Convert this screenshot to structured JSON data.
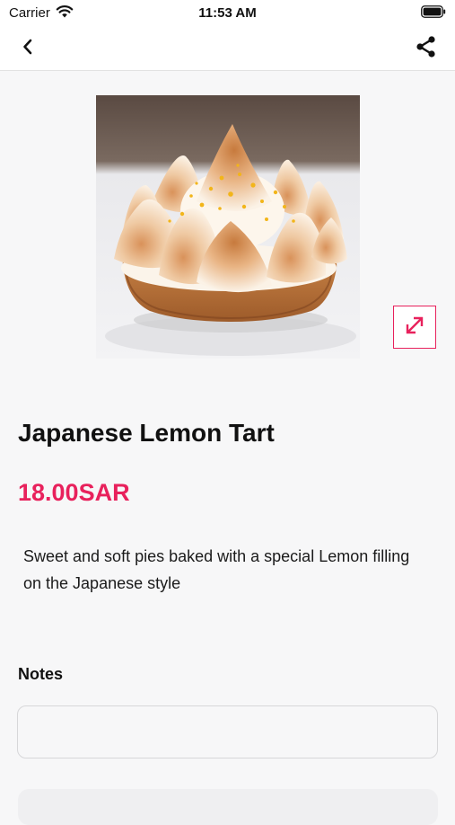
{
  "status_bar": {
    "carrier": "Carrier",
    "time": "11:53 AM"
  },
  "nav": {
    "back_icon": "chevron-left-icon",
    "share_icon": "share-icon"
  },
  "product": {
    "image_description": "lemon tart with toasted meringue peaks",
    "title": "Japanese Lemon Tart",
    "price": "18.00SAR",
    "description": "Sweet and soft pies baked with a special Lemon filling on the Japanese style",
    "expand_icon": "expand-icon"
  },
  "notes": {
    "label": "Notes",
    "value": "",
    "placeholder": ""
  },
  "colors": {
    "accent": "#e8215c",
    "background": "#f7f7f8"
  }
}
